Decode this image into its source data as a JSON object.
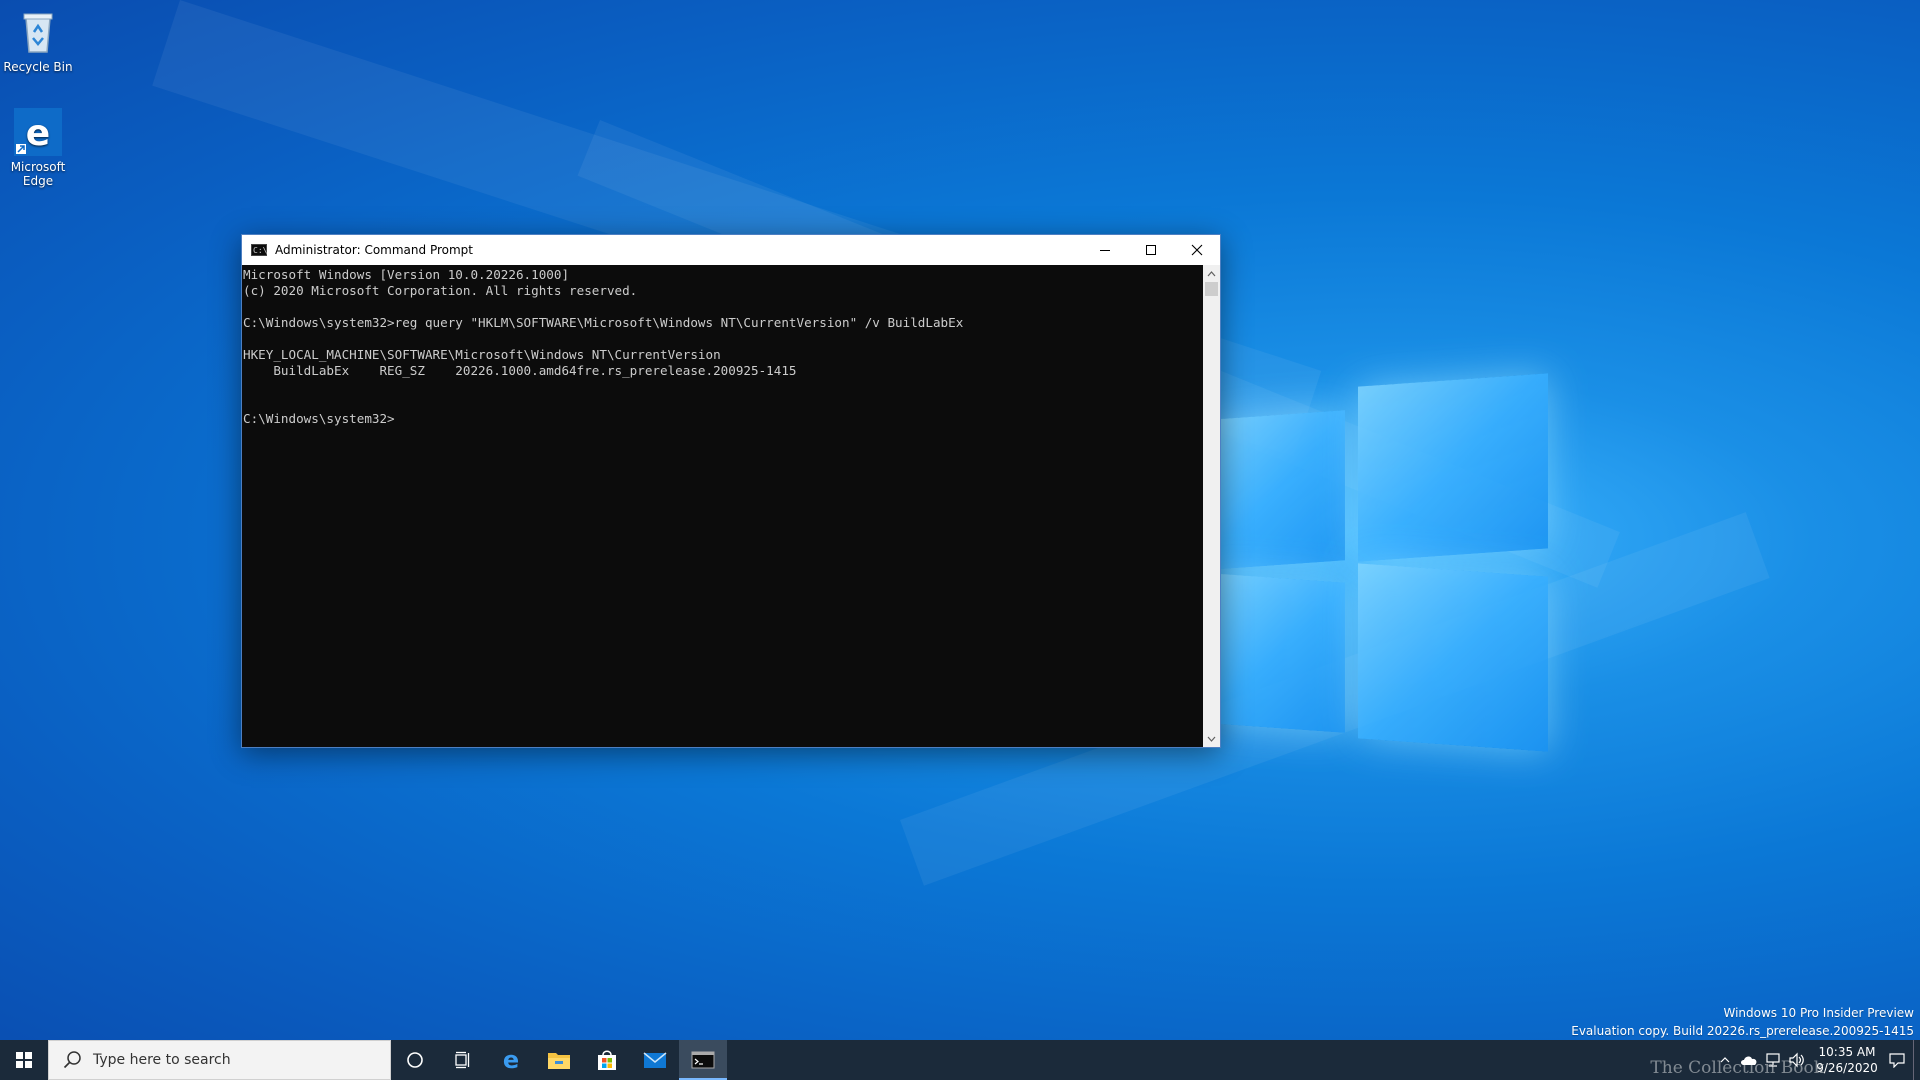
{
  "desktop": {
    "icons": [
      {
        "label": "Recycle Bin",
        "icon": "recycle-bin-icon"
      },
      {
        "label": "Microsoft Edge",
        "icon": "edge-icon"
      }
    ],
    "watermark": {
      "line1": "Windows 10 Pro Insider Preview",
      "line2": "Evaluation copy. Build 20226.rs_prerelease.200925-1415"
    }
  },
  "window": {
    "title": "Administrator: Command Prompt",
    "icon": "cmd-icon",
    "controls": {
      "minimize": "minimize-icon",
      "maximize": "maximize-icon",
      "close": "close-icon"
    },
    "console_lines": [
      "Microsoft Windows [Version 10.0.20226.1000]",
      "(c) 2020 Microsoft Corporation. All rights reserved.",
      "",
      "C:\\Windows\\system32>reg query \"HKLM\\SOFTWARE\\Microsoft\\Windows NT\\CurrentVersion\" /v BuildLabEx",
      "",
      "HKEY_LOCAL_MACHINE\\SOFTWARE\\Microsoft\\Windows NT\\CurrentVersion",
      "    BuildLabEx    REG_SZ    20226.1000.amd64fre.rs_prerelease.200925-1415",
      "",
      "",
      "C:\\Windows\\system32>"
    ]
  },
  "taskbar": {
    "search_placeholder": "Type here to search",
    "pinned": [
      "cortana-icon",
      "task-view-icon",
      "edge-icon",
      "file-explorer-icon",
      "store-icon",
      "mail-icon",
      "command-prompt-icon"
    ],
    "active_app": "command-prompt-icon",
    "clock": {
      "time": "10:35 AM",
      "date": "9/26/2020"
    },
    "tray_icons": [
      "show-hidden-icon",
      "onedrive-icon",
      "network-icon",
      "volume-icon",
      "notifications-icon"
    ],
    "brand": "The Collection Book"
  },
  "colors": {
    "accent": "#0078d7",
    "console_bg": "#0c0c0c",
    "console_fg": "#cccccc",
    "taskbar": "#1b2a3a"
  }
}
